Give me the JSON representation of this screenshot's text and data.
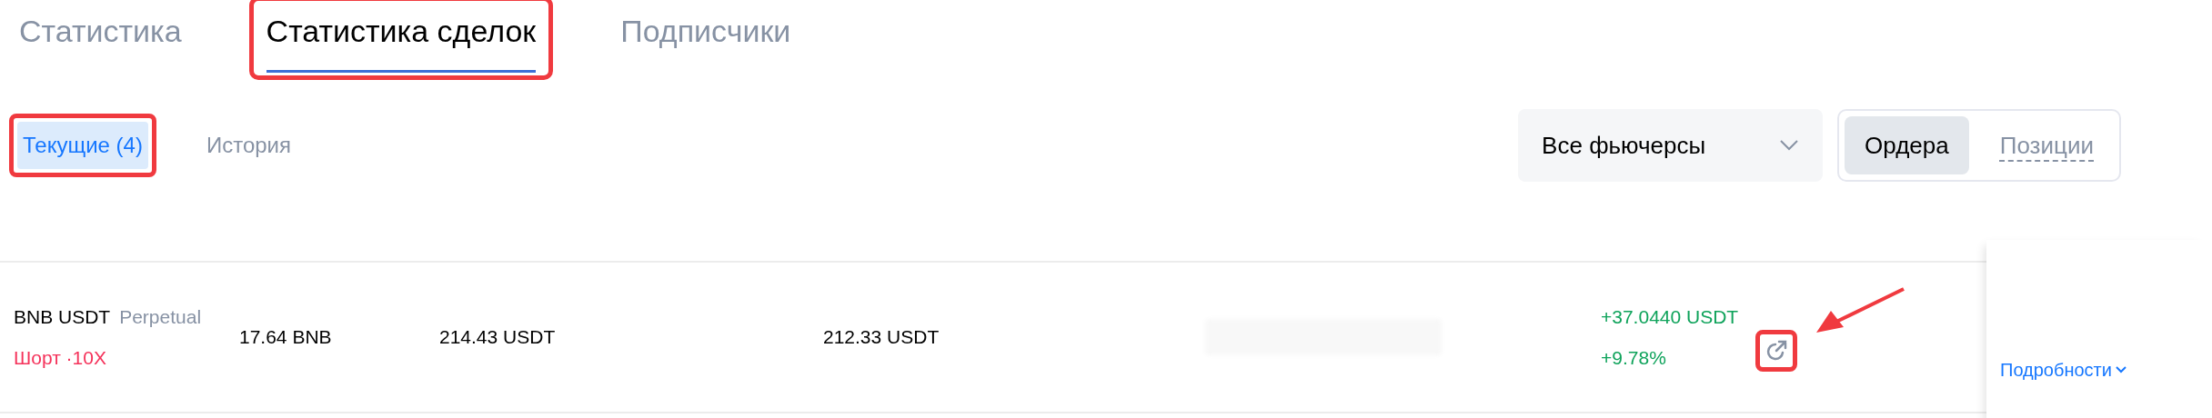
{
  "tabs": [
    {
      "label": "Статистика",
      "selected": false,
      "highlighted": false
    },
    {
      "label": "Статистика сделок",
      "selected": true,
      "highlighted": true
    },
    {
      "label": "Подписчики",
      "selected": false,
      "highlighted": false
    }
  ],
  "subtabs": [
    {
      "label": "Текущие (4)",
      "selected": true,
      "highlighted": true
    },
    {
      "label": "История",
      "selected": false,
      "highlighted": false
    }
  ],
  "filter": {
    "value": "Все фьючерсы"
  },
  "view_toggle": [
    {
      "label": "Ордера",
      "selected": true
    },
    {
      "label": "Позиции",
      "selected": false
    }
  ],
  "rows": [
    {
      "symbol": "BNB USDT",
      "contract": "Perpetual",
      "side": "Шорт ·10X",
      "size": "17.64 BNB",
      "entry_price": "214.43 USDT",
      "mark_price": "212.33 USDT",
      "pnl": "+37.0440 USDT",
      "roe": "+9.78%",
      "share_highlighted": true,
      "share_arrow": true,
      "details": "Подробности"
    }
  ]
}
